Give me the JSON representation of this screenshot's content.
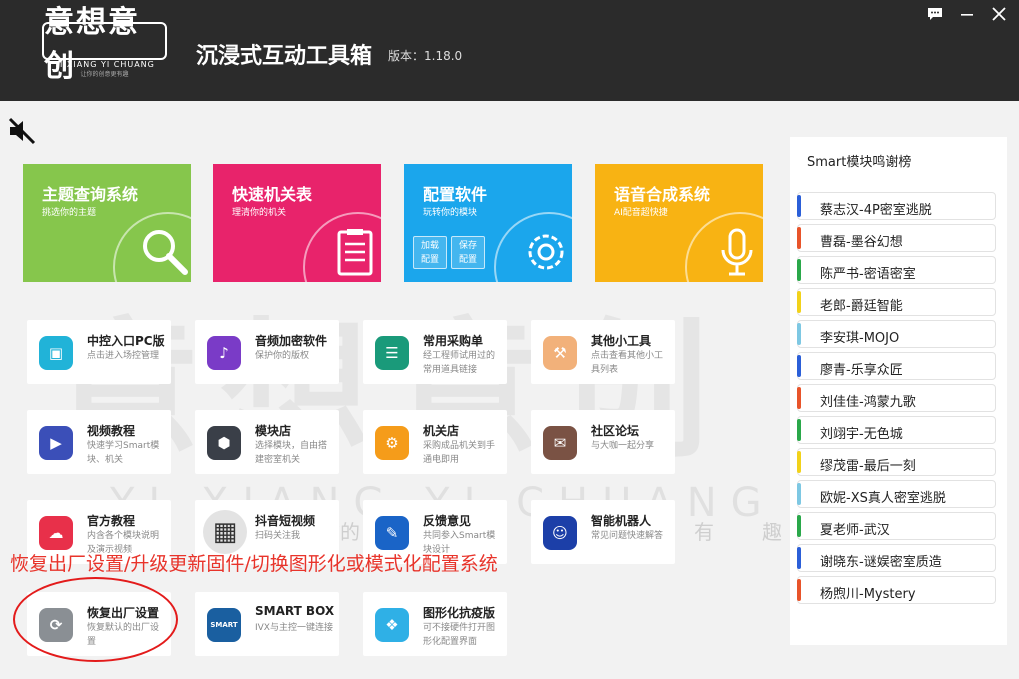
{
  "header": {
    "logo_text": "意想意创",
    "logo_sub": "YI XIANG YI CHUANG",
    "logo_sub2": "让你的创意更有趣",
    "title": "沉浸式互动工具箱",
    "version": "版本：1.18.0"
  },
  "watermark": {
    "main": "意想意创",
    "sub": "YI XIANG YI CHUANG",
    "left": "让你的",
    "mid": "有",
    "right": "趣"
  },
  "tiles": [
    {
      "title": "主题查询系统",
      "sub": "挑选你的主题",
      "color": "#86c64c",
      "icon": "magnifier-icon"
    },
    {
      "title": "快速机关表",
      "sub": "理清你的机关",
      "color": "#e8236b",
      "icon": "clipboard-icon"
    },
    {
      "title": "配置软件",
      "sub": "玩转你的模块",
      "color": "#1ba6ec",
      "icon": "gear-chip-icon",
      "mini1": "加载\n配置",
      "mini2": "保存\n配置"
    },
    {
      "title": "语音合成系统",
      "sub": "AI配音超快捷",
      "color": "#f8b313",
      "icon": "microphone-icon"
    }
  ],
  "cards": [
    {
      "title": "中控入口PC版",
      "sub": "点击进入场控管理",
      "color": "#21b3d8",
      "icon": "monitor-icon"
    },
    {
      "title": "音频加密软件",
      "sub": "保护你的版权",
      "color": "#7a3bc7",
      "icon": "music-note-icon"
    },
    {
      "title": "常用采购单",
      "sub": "经工程师试用过的常用道具链接",
      "color": "#1a9a7a",
      "icon": "list-icon"
    },
    {
      "title": "其他小工具",
      "sub": "点击查看其他小工具列表",
      "color": "#f2b17a",
      "icon": "toolbox-icon"
    },
    {
      "title": "视频教程",
      "sub": "快速学习Smart模块、机关",
      "color": "#3b4fb8",
      "icon": "play-icon"
    },
    {
      "title": "模块店",
      "sub": "选择模块，自由搭建密室机关",
      "color": "#3a3f48",
      "icon": "hexagon-icon"
    },
    {
      "title": "机关店",
      "sub": "采购成品机关到手通电即用",
      "color": "#f59c1a",
      "icon": "gears-icon"
    },
    {
      "title": "社区论坛",
      "sub": "与大咖一起分享",
      "color": "#7a5244",
      "icon": "chat-icon"
    },
    {
      "title": "官方教程",
      "sub": "内含各个模块说明及演示视频",
      "color": "#e8304a",
      "icon": "cloud-icon"
    },
    {
      "title": "抖音短视频",
      "sub": "扫码关注我",
      "color": "#e3e3e3",
      "icon": "qr-code-icon"
    },
    {
      "title": "反馈意见",
      "sub": "共同参入Smart模块设计",
      "color": "#1a64c7",
      "icon": "feedback-icon"
    },
    {
      "title": "智能机器人",
      "sub": "常见问题快速解答",
      "color": "#1c3fa8",
      "icon": "robot-icon"
    },
    {
      "title": "恢复出厂设置",
      "sub": "恢复默认的出厂设置",
      "color": "#8a8f94",
      "icon": "reset-icon"
    },
    {
      "title": "SMART BOX",
      "sub": "IVX与主控一键连接",
      "color": "#1a5fa0",
      "icon": "smart-box-icon",
      "icon_text": "SMART"
    },
    {
      "title": "图形化抗疫版",
      "sub": "可不接硬件打开图形化配置界面",
      "color": "#2fb0e6",
      "icon": "graphic-config-icon"
    }
  ],
  "annotation": "恢复出厂设置/升级更新固件/切换图形化或模式化配置系统",
  "panel": {
    "title": "Smart模块鸣谢榜",
    "items": [
      {
        "label": "蔡志汉-4P密室逃脱",
        "color": "#2b5fd8"
      },
      {
        "label": "曹磊-墨谷幻想",
        "color": "#e8542a"
      },
      {
        "label": "陈严书-密语密室",
        "color": "#2aa84a"
      },
      {
        "label": "老郎-爵廷智能",
        "color": "#f2d21a"
      },
      {
        "label": "李安琪-MOJO",
        "color": "#7ec8e3"
      },
      {
        "label": "廖青-乐享众匠",
        "color": "#2b5fd8"
      },
      {
        "label": "刘佳佳-鸿蒙九歌",
        "color": "#e8542a"
      },
      {
        "label": "刘翊宇-无色城",
        "color": "#2aa84a"
      },
      {
        "label": "缪茂雷-最后一刻",
        "color": "#f2d21a"
      },
      {
        "label": "欧妮-XS真人密室逃脱",
        "color": "#7ec8e3"
      },
      {
        "label": "夏老师-武汉",
        "color": "#2aa84a"
      },
      {
        "label": "谢晓东-谜娱密室质造",
        "color": "#2b5fd8"
      },
      {
        "label": "杨煦川-Mystery",
        "color": "#e8542a"
      }
    ]
  }
}
